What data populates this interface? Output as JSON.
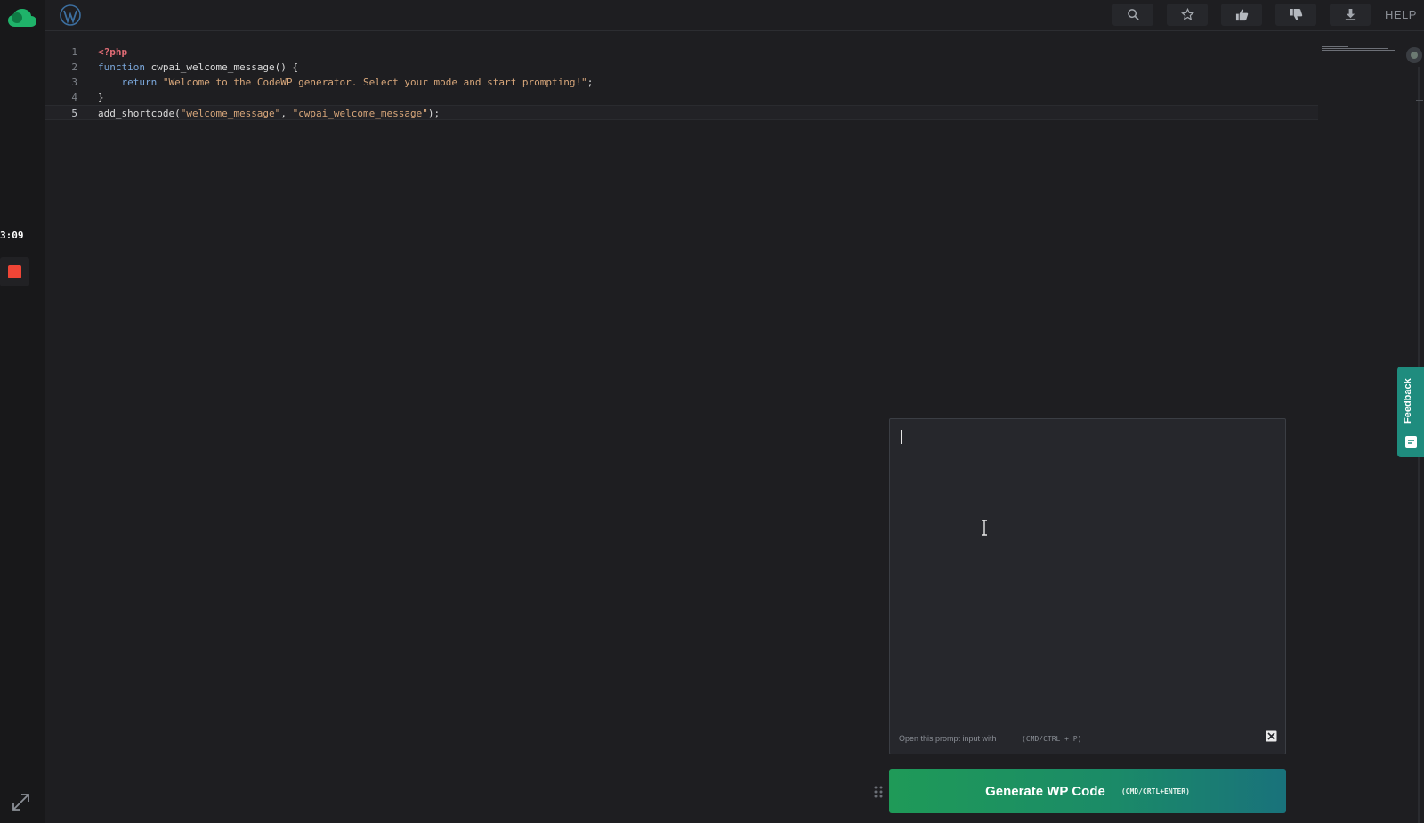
{
  "recording": {
    "timer": "3:09"
  },
  "toolbar": {
    "buttons": [
      {
        "name": "search",
        "icon": "search-icon"
      },
      {
        "name": "star",
        "icon": "star-icon"
      },
      {
        "name": "thumbs-up",
        "icon": "thumbs-up-icon"
      },
      {
        "name": "thumbs-down",
        "icon": "thumbs-down-icon"
      },
      {
        "name": "download",
        "icon": "download-icon"
      }
    ],
    "help_label": "HELP"
  },
  "editor": {
    "lines": [
      {
        "num": "1",
        "tokens": [
          {
            "t": "<?php",
            "c": "k-tag"
          }
        ]
      },
      {
        "num": "2",
        "tokens": [
          {
            "t": "function",
            "c": "k-kw"
          },
          {
            "t": " cwpai_welcome_message() {",
            "c": "k-fn"
          }
        ]
      },
      {
        "num": "3",
        "tokens": [
          {
            "t": "    return",
            "c": "k-kw"
          },
          {
            "t": " ",
            "c": "k-fn"
          },
          {
            "t": "\"Welcome to the CodeWP generator. Select your mode and start prompting!\"",
            "c": "k-str"
          },
          {
            "t": ";",
            "c": "k-fn"
          }
        ]
      },
      {
        "num": "4",
        "tokens": [
          {
            "t": "}",
            "c": "k-fn"
          }
        ]
      },
      {
        "num": "5",
        "tokens": [
          {
            "t": "add_shortcode(",
            "c": "k-fn"
          },
          {
            "t": "\"welcome_message\"",
            "c": "k-str"
          },
          {
            "t": ", ",
            "c": "k-fn"
          },
          {
            "t": "\"cwpai_welcome_message\"",
            "c": "k-str"
          },
          {
            "t": ");",
            "c": "k-fn"
          }
        ]
      }
    ],
    "active_line": "5"
  },
  "feedback": {
    "label": "Feedback"
  },
  "prompt": {
    "value": "",
    "hint": "Open this prompt input with",
    "hint_shortcut": "(CMD/CTRL + P)"
  },
  "generate": {
    "label": "Generate WP Code",
    "shortcut": "(CMD/CRTL+ENTER)"
  },
  "colors": {
    "accent_start": "#1f9a58",
    "accent_end": "#19727b",
    "record": "#ef4536",
    "feedback": "#1f8c7e"
  }
}
